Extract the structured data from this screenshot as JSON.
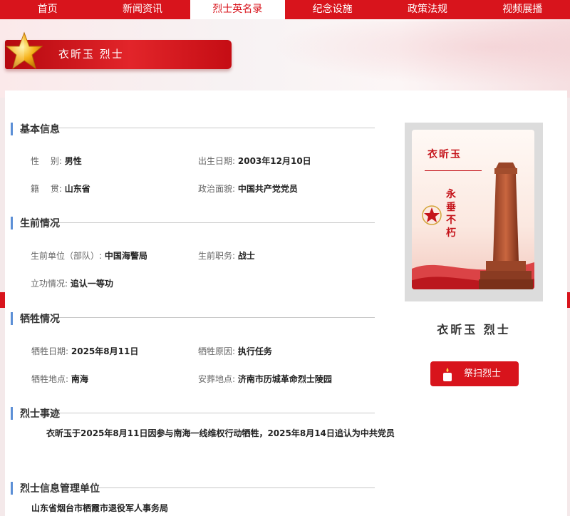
{
  "nav": {
    "items": [
      {
        "label": "首页"
      },
      {
        "label": "新闻资讯"
      },
      {
        "label": "烈士英名录",
        "active": true
      },
      {
        "label": "纪念设施"
      },
      {
        "label": "政策法规"
      },
      {
        "label": "视频展播"
      }
    ]
  },
  "banner": {
    "title": "衣昕玉 烈士"
  },
  "basic": {
    "title": "基本信息",
    "gender_label": "性　 别:",
    "gender": "男性",
    "birth_label": "出生日期:",
    "birth": "2003年12月10日",
    "origin_label": "籍　 贯:",
    "origin": "山东省",
    "politics_label": "政治面貌:",
    "politics": "中国共产党党员"
  },
  "life": {
    "title": "生前情况",
    "unit_label": "生前单位（部队）:",
    "unit": "中国海警局",
    "post_label": "生前职务:",
    "post": "战士",
    "merit_label": "立功情况:",
    "merit": "追认一等功"
  },
  "sacrifice": {
    "title": "牺牲情况",
    "date_label": "牺牲日期:",
    "date": "2025年8月11日",
    "cause_label": "牺牲原因:",
    "cause": "执行任务",
    "place_label": "牺牲地点:",
    "place": "南海",
    "burial_label": "安葬地点:",
    "burial": "济南市历城革命烈士陵园"
  },
  "deeds": {
    "title": "烈士事迹",
    "text": "衣昕玉于2025年8月11日因参与南海一线维权行动牺牲，2025年8月14日追认为中共党员"
  },
  "management": {
    "title": "烈士信息管理单位",
    "org": "山东省烟台市栖霞市退役军人事务局"
  },
  "portrait": {
    "name": "衣昕玉",
    "motto": "永垂不朽"
  },
  "profile": {
    "name": "衣昕玉 烈士"
  },
  "tribute": {
    "label": "祭扫烈士"
  },
  "colors": {
    "primary_red": "#d8141c",
    "section_bar": "#5c8fd6"
  }
}
